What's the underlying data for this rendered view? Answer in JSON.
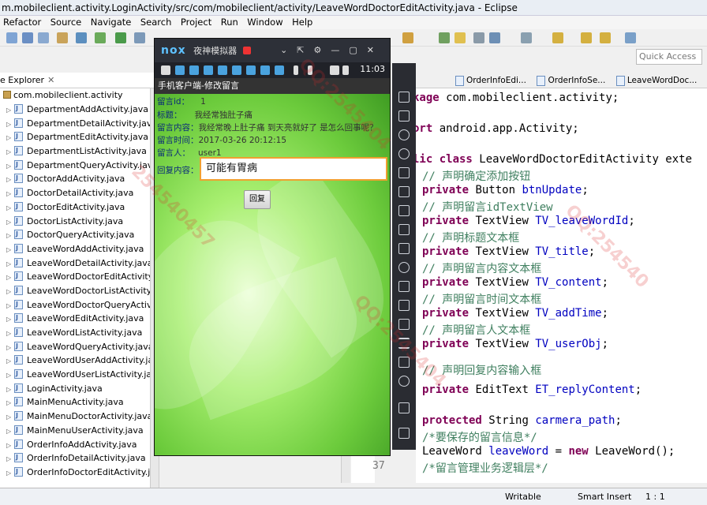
{
  "window": {
    "title": "m.mobileclient.activity.LoginActivity/src/com/mobileclient/activity/LeaveWordDoctorEditActivity.java - Eclipse"
  },
  "menu": [
    "Refactor",
    "Source",
    "Navigate",
    "Search",
    "Project",
    "Run",
    "Window",
    "Help"
  ],
  "quick_access": {
    "placeholder": "Quick Access"
  },
  "explorer": {
    "tab_label": "e Explorer",
    "package": "com.mobileclient.activity",
    "files": [
      "DepartmentAddActivity.java",
      "DepartmentDetailActivity.java",
      "DepartmentEditActivity.java",
      "DepartmentListActivity.java",
      "DepartmentQueryActivity.java",
      "DoctorAddActivity.java",
      "DoctorDetailActivity.java",
      "DoctorEditActivity.java",
      "DoctorListActivity.java",
      "DoctorQueryActivity.java",
      "LeaveWordAddActivity.java",
      "LeaveWordDetailActivity.java",
      "LeaveWordDoctorEditActivity.java",
      "LeaveWordDoctorListActivity.java",
      "LeaveWordDoctorQueryActivity.java",
      "LeaveWordEditActivity.java",
      "LeaveWordListActivity.java",
      "LeaveWordQueryActivity.java",
      "LeaveWordUserAddActivity.java",
      "LeaveWordUserListActivity.java",
      "LoginActivity.java",
      "MainMenuActivity.java",
      "MainMenuDoctorActivity.java",
      "MainMenuUserActivity.java",
      "OrderInfoAddActivity.java",
      "OrderInfoDetailActivity.java",
      "OrderInfoDoctorEditActivity.java"
    ]
  },
  "emulator": {
    "brand": "nox",
    "name": "夜神模拟器",
    "time": "11:03",
    "app_title": "手机客户端-修改留言",
    "fields": [
      {
        "label": "留言id：",
        "value": "1"
      },
      {
        "label": "标题：",
        "value": "我经常独肚子痛"
      },
      {
        "label": "留言内容：",
        "value": "我经常晚上肚子痛 到天亮就好了 是怎么回事呢？"
      },
      {
        "label": "留言时间：",
        "value": "2017-03-26 20:12:15"
      },
      {
        "label": "留言人：",
        "value": "user1"
      }
    ],
    "reply_label": "回复内容：",
    "reply_value": "可能有胃病",
    "reply_button": "回复"
  },
  "editor": {
    "tabs": [
      "OrderInfoEdi...",
      "OrderInfoSe...",
      "LeaveWordDoc..."
    ],
    "code": [
      {
        "parts": [
          [
            "kw",
            "kage "
          ],
          [
            "",
            "com.mobileclient.activity;"
          ]
        ]
      },
      {
        "parts": [
          [
            "kw",
            "ort "
          ],
          [
            "",
            "android.app.Activity;"
          ]
        ]
      },
      {
        "parts": [
          [
            "kw",
            "lic class "
          ],
          [
            "",
            "LeaveWordDoctorEditActivity exte"
          ]
        ]
      },
      {
        "parts": [
          [
            "cm",
            "// 声明确定添加按钮"
          ]
        ]
      },
      {
        "parts": [
          [
            "kw",
            "private "
          ],
          [
            "",
            "Button "
          ],
          [
            "fld",
            "btnUpdate"
          ],
          [
            "",
            ";"
          ]
        ]
      },
      {
        "parts": [
          [
            "cm",
            "// 声明留言idTextView"
          ]
        ]
      },
      {
        "parts": [
          [
            "kw",
            "private "
          ],
          [
            "",
            "TextView "
          ],
          [
            "fld",
            "TV_leaveWordId"
          ],
          [
            "",
            ";"
          ]
        ]
      },
      {
        "parts": [
          [
            "cm",
            "// 声明标题文本框"
          ]
        ]
      },
      {
        "parts": [
          [
            "kw",
            "private "
          ],
          [
            "",
            "TextView "
          ],
          [
            "fld",
            "TV_title"
          ],
          [
            "",
            ";"
          ]
        ]
      },
      {
        "parts": [
          [
            "cm",
            "// 声明留言内容文本框"
          ]
        ]
      },
      {
        "parts": [
          [
            "kw",
            "private "
          ],
          [
            "",
            "TextView "
          ],
          [
            "fld",
            "TV_content"
          ],
          [
            "",
            ";"
          ]
        ]
      },
      {
        "parts": [
          [
            "cm",
            "// 声明留言时间文本框"
          ]
        ]
      },
      {
        "parts": [
          [
            "kw",
            "private "
          ],
          [
            "",
            "TextView "
          ],
          [
            "fld",
            "TV_addTime"
          ],
          [
            "",
            ";"
          ]
        ]
      },
      {
        "parts": [
          [
            "cm",
            "// 声明留言人文本框"
          ]
        ]
      },
      {
        "parts": [
          [
            "kw",
            "private "
          ],
          [
            "",
            "TextView "
          ],
          [
            "fld",
            "TV_userObj"
          ],
          [
            "",
            ";"
          ]
        ]
      },
      {
        "parts": [
          [
            "cm",
            "// 声明回复内容输入框"
          ]
        ]
      },
      {
        "parts": [
          [
            "kw",
            "private "
          ],
          [
            "",
            "EditText "
          ],
          [
            "fld",
            "ET_replyContent"
          ],
          [
            "",
            ";"
          ]
        ]
      },
      {
        "parts": [
          [
            "kw",
            "protected "
          ],
          [
            "",
            "String "
          ],
          [
            "fld",
            "carmera_path"
          ],
          [
            "",
            ";"
          ]
        ]
      },
      {
        "parts": [
          [
            "cm",
            "/*要保存的留言信息*/"
          ]
        ]
      },
      {
        "parts": [
          [
            "",
            "LeaveWord "
          ],
          [
            "fld",
            "leaveWord"
          ],
          [
            "",
            " = "
          ],
          [
            "kw",
            "new "
          ],
          [
            "",
            "LeaveWord();"
          ]
        ]
      },
      {
        "parts": [
          [
            "cm",
            "/*留言管理业务逻辑层*/"
          ]
        ]
      }
    ],
    "line_number": "37"
  },
  "status": {
    "writable": "Writable",
    "insert_mode": "Smart Insert",
    "position": "1 : 1"
  }
}
